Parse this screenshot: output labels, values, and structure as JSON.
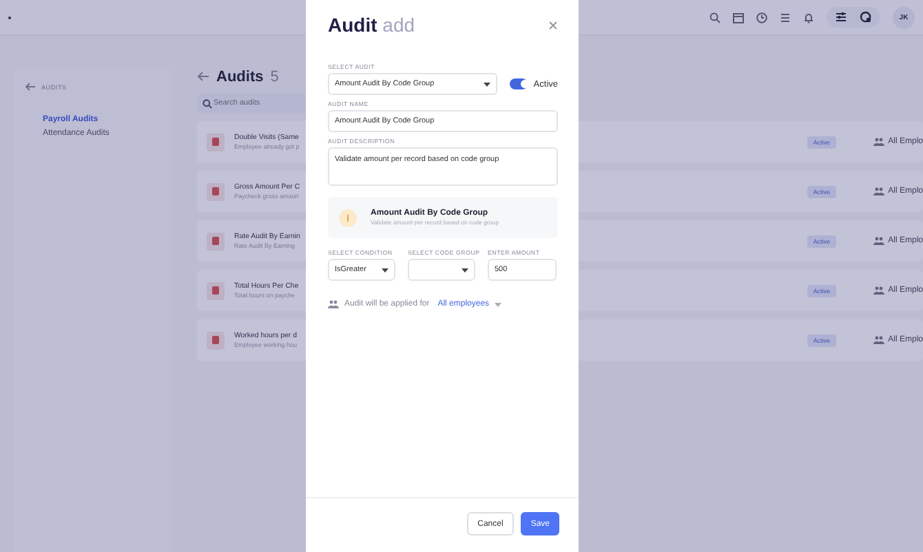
{
  "top_bar": {
    "avatar": "JK"
  },
  "sidebar": {
    "back_label": "AUDITS",
    "items": [
      {
        "label": "Payroll Audits",
        "selected": true
      },
      {
        "label": "Attendance Audits",
        "selected": false
      }
    ]
  },
  "page": {
    "title": "Audits",
    "count": "5",
    "search": {
      "placeholder": "Search audits"
    }
  },
  "audits": [
    {
      "title": "Double Visits (Same",
      "subtitle": "Employee already got p",
      "status": "Active",
      "applies_to": "All Emplo"
    },
    {
      "title": "Gross Amount Per C",
      "subtitle": "Paycheck gross amoun",
      "status": "Active",
      "applies_to": "All Emplo"
    },
    {
      "title": "Rate Audit By Earnin",
      "subtitle": "Rate Audit By Earning",
      "status": "Active",
      "applies_to": "All Emplo"
    },
    {
      "title": "Total Hours Per Che",
      "subtitle": "Total hours on payche",
      "status": "Active",
      "applies_to": "All Emplo"
    },
    {
      "title": "Worked hours per d",
      "subtitle": "Employee working hou",
      "status": "Active",
      "applies_to": "All Emplo"
    }
  ],
  "modal": {
    "title": "Audit",
    "title_suffix": "add",
    "select_audit": {
      "label": "SELECT AUDIT",
      "value": "Amount Audit By Code Group"
    },
    "active_toggle": {
      "label": "Active",
      "on": true
    },
    "audit_name": {
      "label": "AUDIT NAME",
      "value": "Amount Audit By Code Group"
    },
    "audit_description": {
      "label": "AUDIT DESCRIPTION",
      "value": "Validate amount per record based on code group"
    },
    "info_card": {
      "title": "Amount Audit By Code Group",
      "subtitle": "Validate amount per record based on code group"
    },
    "select_condition": {
      "label": "SELECT CONDITION",
      "value": "IsGreater"
    },
    "select_code_group": {
      "label": "SELECT CODE GROUP"
    },
    "enter_amount": {
      "label": "ENTER AMOUNT",
      "value": "500"
    },
    "applies": {
      "text": "Audit will be applied for",
      "link": "All employees"
    },
    "buttons": {
      "cancel": "Cancel",
      "save": "Save"
    }
  }
}
